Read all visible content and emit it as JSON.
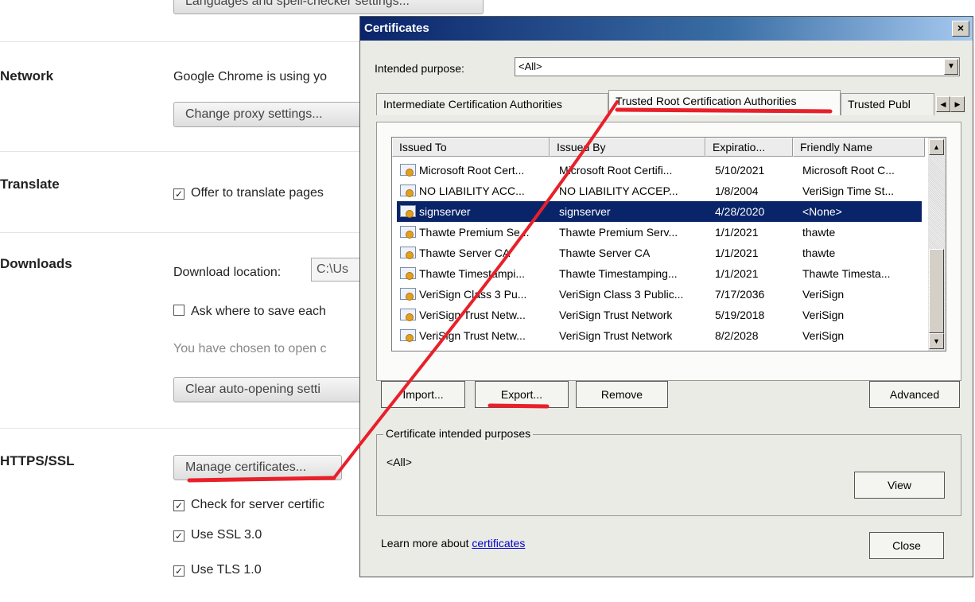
{
  "settings": {
    "top_button": "Languages and spell-checker settings...",
    "network": {
      "title": "Network",
      "description": "Google Chrome is using yo",
      "proxy_button": "Change proxy settings..."
    },
    "translate": {
      "title": "Translate",
      "offer_label": "Offer to translate pages",
      "offer_checked": true
    },
    "downloads": {
      "title": "Downloads",
      "location_label": "Download location:",
      "location_value": "C:\\Us",
      "ask_label": "Ask where to save each",
      "ask_checked": false,
      "auto_open_text": "You have chosen to open c",
      "clear_button": "Clear auto-opening setti"
    },
    "https": {
      "title": "HTTPS/SSL",
      "manage_button": "Manage certificates...",
      "check_revocation_label": "Check for server certific",
      "ssl3_label": "Use SSL 3.0",
      "tls1_label": "Use TLS 1.0"
    }
  },
  "dialog": {
    "title": "Certificates",
    "close_glyph": "×",
    "purpose_label": "Intended purpose:",
    "purpose_value": "<All>",
    "tabs": [
      {
        "label": "Intermediate Certification Authorities",
        "active": false
      },
      {
        "label": "Trusted Root Certification Authorities",
        "active": true
      },
      {
        "label": "Trusted Publ",
        "active": false
      }
    ],
    "columns": [
      "Issued To",
      "Issued By",
      "Expiratio...",
      "Friendly Name"
    ],
    "rows": [
      {
        "issued_to": "Microsoft Root Cert...",
        "issued_by": "Microsoft Root Certifi...",
        "expiration": "5/10/2021",
        "friendly": "Microsoft Root C...",
        "selected": false
      },
      {
        "issued_to": "NO LIABILITY ACC...",
        "issued_by": "NO LIABILITY ACCEP...",
        "expiration": "1/8/2004",
        "friendly": "VeriSign Time St...",
        "selected": false
      },
      {
        "issued_to": "signserver",
        "issued_by": "signserver",
        "expiration": "4/28/2020",
        "friendly": "<None>",
        "selected": true
      },
      {
        "issued_to": "Thawte Premium Se...",
        "issued_by": "Thawte Premium Serv...",
        "expiration": "1/1/2021",
        "friendly": "thawte",
        "selected": false
      },
      {
        "issued_to": "Thawte Server CA",
        "issued_by": "Thawte Server CA",
        "expiration": "1/1/2021",
        "friendly": "thawte",
        "selected": false
      },
      {
        "issued_to": "Thawte Timestampi...",
        "issued_by": "Thawte Timestamping...",
        "expiration": "1/1/2021",
        "friendly": "Thawte Timesta...",
        "selected": false
      },
      {
        "issued_to": "VeriSign Class 3 Pu...",
        "issued_by": "VeriSign Class 3 Public...",
        "expiration": "7/17/2036",
        "friendly": "VeriSign",
        "selected": false
      },
      {
        "issued_to": "VeriSign Trust Netw...",
        "issued_by": "VeriSign Trust Network",
        "expiration": "5/19/2018",
        "friendly": "VeriSign",
        "selected": false
      },
      {
        "issued_to": "VeriSign Trust Netw...",
        "issued_by": "VeriSign Trust Network",
        "expiration": "8/2/2028",
        "friendly": "VeriSign",
        "selected": false
      }
    ],
    "buttons": {
      "import": "Import...",
      "export": "Export...",
      "remove": "Remove",
      "advanced": "Advanced",
      "view": "View",
      "close": "Close"
    },
    "purposes_group": {
      "title": "Certificate intended purposes",
      "value": "<All>"
    },
    "learn_more_prefix": "Learn more about ",
    "learn_more_link": "certificates"
  },
  "colors": {
    "selection": "#0a246a",
    "annotation": "#e8202a",
    "link": "#0000cc"
  }
}
